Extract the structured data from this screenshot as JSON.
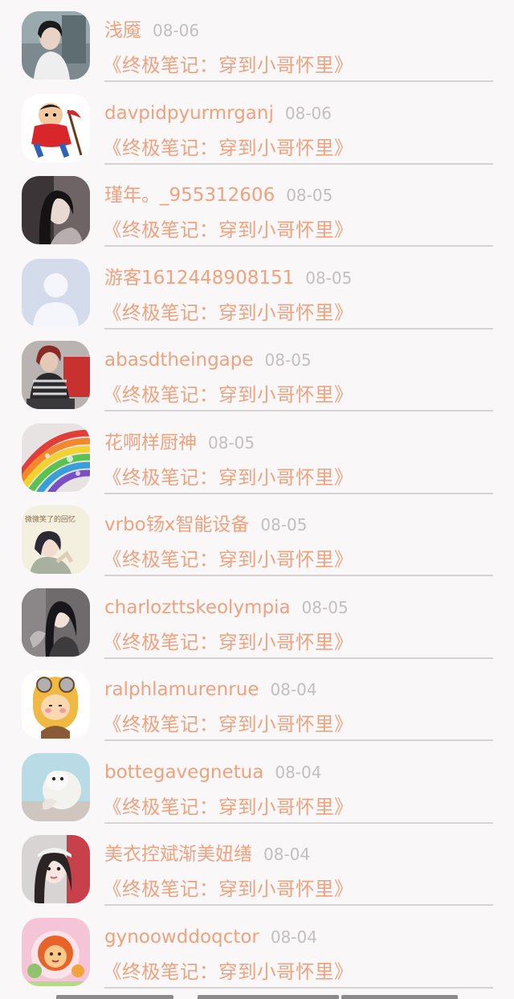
{
  "items": [
    {
      "name": "浅魇",
      "date": "08-06",
      "book": "《终极笔记：穿到小哥怀里》"
    },
    {
      "name": "davpidpyurmrganj",
      "date": "08-06",
      "book": "《终极笔记：穿到小哥怀里》"
    },
    {
      "name": "瑾年。_955312606",
      "date": "08-05",
      "book": "《终极笔记：穿到小哥怀里》"
    },
    {
      "name": "游客1612448908151",
      "date": "08-05",
      "book": "《终极笔记：穿到小哥怀里》"
    },
    {
      "name": "abasdtheingape",
      "date": "08-05",
      "book": "《终极笔记：穿到小哥怀里》"
    },
    {
      "name": "花啊样厨神",
      "date": "08-05",
      "book": "《终极笔记：穿到小哥怀里》"
    },
    {
      "name": "vrbo钖x智能设备",
      "date": "08-05",
      "book": "《终极笔记：穿到小哥怀里》"
    },
    {
      "name": "charlozttskeolympia",
      "date": "08-05",
      "book": "《终极笔记：穿到小哥怀里》"
    },
    {
      "name": "ralphlamurenrue",
      "date": "08-04",
      "book": "《终极笔记：穿到小哥怀里》"
    },
    {
      "name": "bottegavegnetua",
      "date": "08-04",
      "book": "《终极笔记：穿到小哥怀里》"
    },
    {
      "name": "美衣控斌渐美妞缮",
      "date": "08-04",
      "book": "《终极笔记：穿到小哥怀里》"
    },
    {
      "name": "gynoowddoqctor",
      "date": "08-04",
      "book": "《终极笔记：穿到小哥怀里》"
    }
  ],
  "avatar_text": {
    "seven": "微微笑了的回忆"
  },
  "colors": {
    "accent": "#eea27e",
    "date": "#c3bfc0",
    "divider": "#d6d3d4",
    "background": "#f9f7f8"
  }
}
